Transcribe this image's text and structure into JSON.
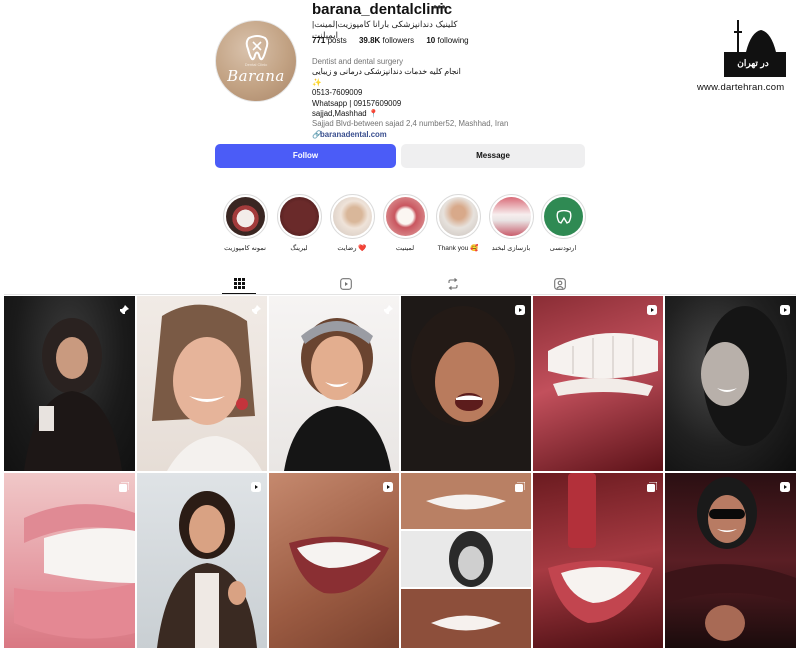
{
  "profile": {
    "username": "barana_dentalclinic",
    "more_icon": "more-horizontal-icon",
    "full_name": "کلینیک دندانپزشکی بارانا کامپوزیت|لمینت|ایمپلنت",
    "logo_text": "Barana",
    "logo_sub": "Dental Clinic",
    "stats": {
      "posts_count": "771",
      "posts_label": "posts",
      "followers_count": "39.8K",
      "followers_label": "followers",
      "following_count": "10",
      "following_label": "following"
    },
    "bio": {
      "category": "Dentist and dental surgery",
      "line1": "انجام کلیه خدمات دندانپزشکی درمانی و زیبایی ✨",
      "line2": "0513-7609009",
      "line3": "Whatsapp | 09157609009",
      "line4": "sajjad,Mashhad 📍",
      "address": "Sajjad Blvd-between sajad 2,4 number52, Mashhad, Iran",
      "link": "baranadental.com"
    }
  },
  "actions": {
    "follow_label": "Follow",
    "message_label": "Message"
  },
  "highlights": [
    {
      "label": "نمونه کامپوزیت"
    },
    {
      "label": "لیرینگ"
    },
    {
      "label": "رضایت ❤️"
    },
    {
      "label": "لمینیت"
    },
    {
      "label": "Thank you 🥰"
    },
    {
      "label": "بازسازی لبخند"
    },
    {
      "label": "ارتودنسی"
    }
  ],
  "tabs": [
    {
      "name": "posts",
      "icon": "grid-icon",
      "active": true
    },
    {
      "name": "reels",
      "icon": "reels-icon",
      "active": false
    },
    {
      "name": "reposts",
      "icon": "repost-icon",
      "active": false
    },
    {
      "name": "tagged",
      "icon": "tagged-user-icon",
      "active": false
    }
  ],
  "grid": [
    {
      "kind": "pinned-post",
      "badge": "pin-icon"
    },
    {
      "kind": "pinned-post",
      "badge": "pin-icon"
    },
    {
      "kind": "pinned-post",
      "badge": "pin-icon"
    },
    {
      "kind": "reel",
      "badge": "reel-icon"
    },
    {
      "kind": "reel",
      "badge": "reel-icon"
    },
    {
      "kind": "reel",
      "badge": "reel-icon"
    },
    {
      "kind": "carousel",
      "badge": "carousel-icon"
    },
    {
      "kind": "reel",
      "badge": "reel-icon"
    },
    {
      "kind": "reel",
      "badge": "reel-icon"
    },
    {
      "kind": "carousel",
      "badge": "carousel-icon"
    },
    {
      "kind": "carousel",
      "badge": "carousel-icon"
    },
    {
      "kind": "reel",
      "badge": "reel-icon"
    }
  ],
  "watermark": {
    "logo_text": "در تهران",
    "site": "www.dartehran.com"
  },
  "colors": {
    "follow_button": "#4b5cf7",
    "message_button": "#efeff0",
    "link": "#3a4f8f",
    "muted_text": "#737373",
    "logo_bg": "#c2a283"
  }
}
